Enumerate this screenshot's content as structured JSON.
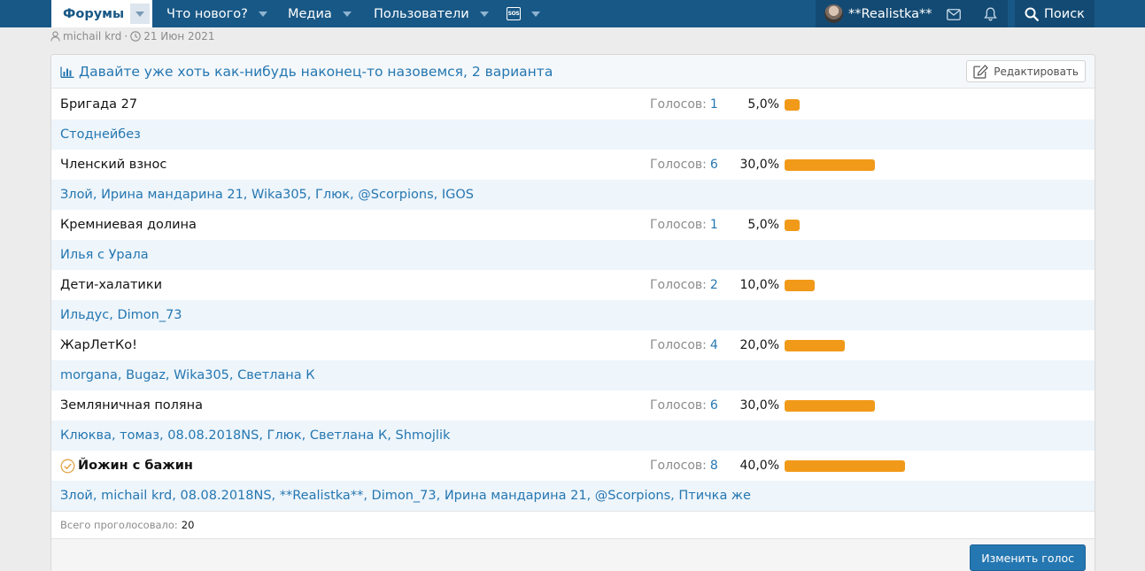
{
  "nav": {
    "forums": "Форумы",
    "whats_new": "Что нового?",
    "media": "Медиа",
    "users": "Пользователи",
    "sos": "SOS",
    "username": "**Realistka**",
    "search": "Поиск"
  },
  "meta": {
    "author": "michail krd",
    "separator": "·",
    "date": "21 Июн 2021"
  },
  "poll": {
    "title": "Давайте уже хоть как-нибудь наконец-то назовемся, 2 варианта",
    "edit_label": "Редактировать",
    "votes_label": "Голосов:",
    "options": [
      {
        "label": "Бригада 27",
        "votes": "1",
        "percent": "5,0%",
        "fraction": 0.05,
        "voters": "Стоднейбез",
        "chosen": false
      },
      {
        "label": "Членский взнос",
        "votes": "6",
        "percent": "30,0%",
        "fraction": 0.3,
        "voters": "Злой, Ирина мандарина 21, Wika305, Глюк, @Scorpions, IGOS",
        "chosen": false
      },
      {
        "label": "Кремниевая долина",
        "votes": "1",
        "percent": "5,0%",
        "fraction": 0.05,
        "voters": "Илья с Урала",
        "chosen": false
      },
      {
        "label": "Дети-халатики",
        "votes": "2",
        "percent": "10,0%",
        "fraction": 0.1,
        "voters": "Ильдус, Dimon_73",
        "chosen": false
      },
      {
        "label": "ЖарЛетКо!",
        "votes": "4",
        "percent": "20,0%",
        "fraction": 0.2,
        "voters": "morgana, Bugaz, Wika305, Светлана К",
        "chosen": false
      },
      {
        "label": "Земляничная поляна",
        "votes": "6",
        "percent": "30,0%",
        "fraction": 0.3,
        "voters": "Клюква, томаз, 08.08.2018NS, Глюк, Светлана К, Shmojlik",
        "chosen": false
      },
      {
        "label": "Йожин с бажин",
        "votes": "8",
        "percent": "40,0%",
        "fraction": 0.4,
        "voters": "Злой, michail krd, 08.08.2018NS, **Realistka**, Dimon_73, Ирина мандарина 21, @Scorpions, Птичка же",
        "chosen": true
      }
    ],
    "total_label": "Всего проголосовало:",
    "total_value": "20",
    "change_vote_label": "Изменить голос"
  },
  "colors": {
    "nav_bg": "#185886",
    "link": "#2577b1",
    "bar": "#f19a1a",
    "voters_bg": "#eef5fb"
  }
}
